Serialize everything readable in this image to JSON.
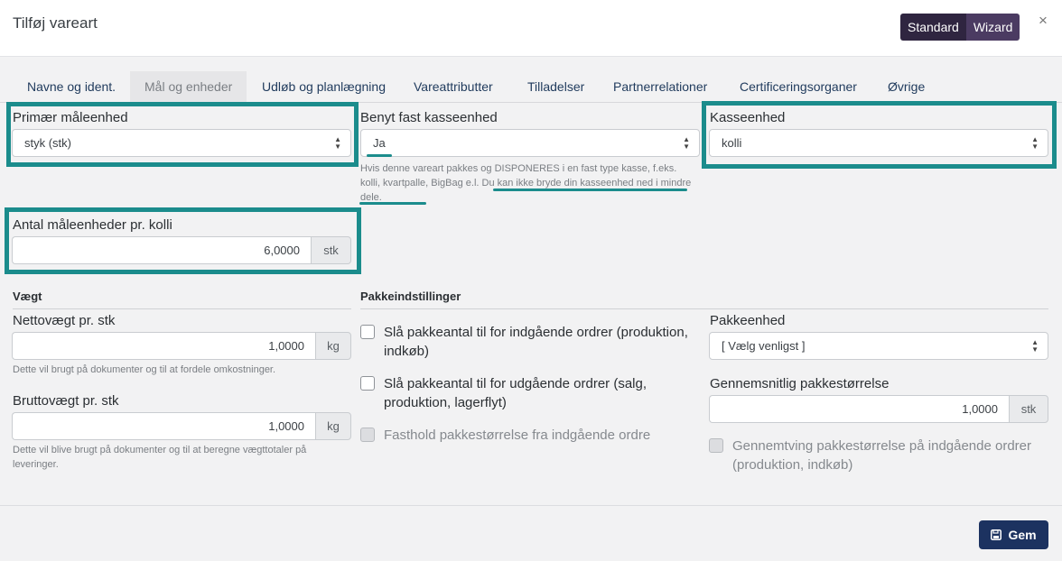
{
  "dialog": {
    "title": "Tilføj vareart"
  },
  "mode": {
    "standard": "Standard",
    "wizard": "Wizard"
  },
  "close_glyph": "×",
  "tabs": [
    {
      "label": "Navne og ident."
    },
    {
      "label": "Mål og enheder",
      "active": true
    },
    {
      "label": "Udløb og planlægning"
    },
    {
      "label": "Vareattributter"
    },
    {
      "label": "Tilladelser"
    },
    {
      "label": "Partnerrelationer"
    },
    {
      "label": "Certificeringsorganer"
    },
    {
      "label": "Øvrige"
    }
  ],
  "primary_unit": {
    "label": "Primær måleenhed",
    "value": "styk (stk)"
  },
  "fixed_case": {
    "label": "Benyt fast kasseenhed",
    "value": "Ja",
    "help": "Hvis denne vareart pakkes og DISPONERES i en fast type kasse, f.eks. kolli, kvartpalle, BigBag e.l. Du kan ikke bryde din kasseenhed ned i mindre dele."
  },
  "case_unit": {
    "label": "Kasseenhed",
    "value": "kolli"
  },
  "units_per_case": {
    "label": "Antal måleenheder pr. kolli",
    "value": "6,0000",
    "unit": "stk"
  },
  "weight": {
    "section": "Vægt",
    "net_label": "Nettovægt pr. stk",
    "net_value": "1,0000",
    "net_unit": "kg",
    "net_help": "Dette vil brugt på dokumenter og til at fordele omkostninger.",
    "gross_label": "Bruttovægt pr. stk",
    "gross_value": "1,0000",
    "gross_unit": "kg",
    "gross_help": "Dette vil blive brugt på dokumenter og til at beregne vægttotaler på leveringer."
  },
  "packing": {
    "section": "Pakkeindstillinger",
    "options": [
      {
        "label": "Slå pakkeantal til for indgående ordrer (produktion, indkøb)",
        "checked": false,
        "disabled": false
      },
      {
        "label": "Slå pakkeantal til for udgående ordrer (salg, produktion, lagerflyt)",
        "checked": false,
        "disabled": false
      },
      {
        "label": "Fasthold pakkestørrelse fra indgående ordre",
        "checked": false,
        "disabled": true
      }
    ],
    "unit_label": "Pakkeenhed",
    "unit_value": "[ Vælg venligst ]",
    "avg_label": "Gennemsnitlig pakkestørrelse",
    "avg_value": "1,0000",
    "avg_unit": "stk",
    "force_label": "Gennemtving pakkestørrelse på indgående ordrer (produktion, indkøb)",
    "force_disabled": true
  },
  "save": {
    "label": "Gem"
  },
  "colors": {
    "highlight": "#1b8c8c",
    "primary": "#1c3260",
    "mode_switch": "#2f2540"
  }
}
